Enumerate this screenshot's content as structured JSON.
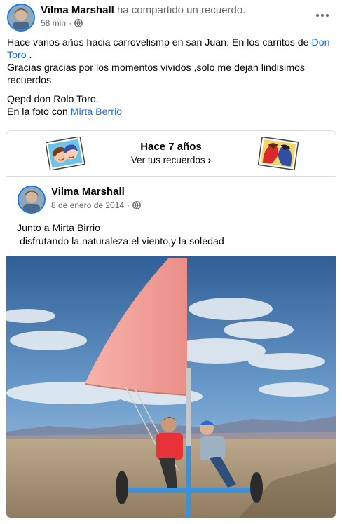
{
  "header": {
    "author": "Vilma Marshall",
    "action": "ha compartido un recuerdo.",
    "time": "58 min",
    "separator": "·"
  },
  "body": {
    "line1": "Hace varios años hacia carrovelismp en san Juan.  En los carritos de ",
    "link1": "Don Toro",
    "line1_end": " .",
    "line2": "Gracias gracias por los momentos vividos ,solo me dejan lindisimos recuerdos",
    "line3": "Qepd don Rolo Toro.",
    "line4_prefix": "En la foto con ",
    "link2": "Mirta Berrio"
  },
  "memory": {
    "title": "Hace 7 años",
    "link": "Ver tus recuerdos",
    "chevron": "›"
  },
  "original_post": {
    "author": "Vilma Marshall",
    "date": "8 de enero de 2014",
    "separator": "·",
    "text": "Junto a Mirta Birrio\n disfrutando la naturaleza,el viento,y la soledad"
  },
  "icons": {
    "more": "more-options-icon",
    "audience": "globe-icon"
  },
  "colors": {
    "link": "#216fdb",
    "secondary_text": "#65676b",
    "avatar_ring": "#1877f2",
    "sail": "#f2a39b"
  }
}
